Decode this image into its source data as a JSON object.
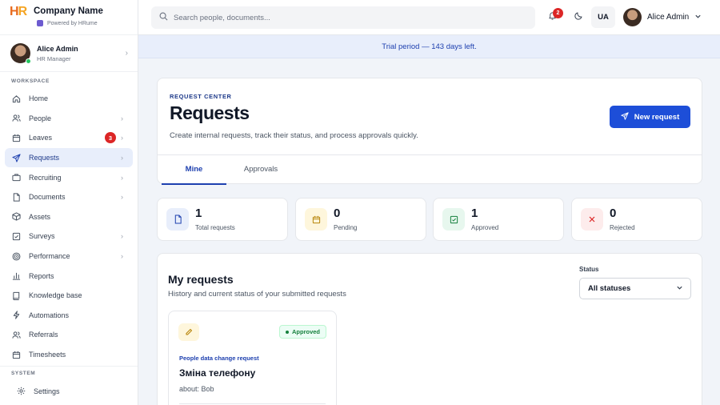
{
  "brand": {
    "logo": "HR",
    "company": "Company Name",
    "powered_by": "Powered by HRume"
  },
  "user": {
    "name": "Alice Admin",
    "role": "HR Manager"
  },
  "sidebar": {
    "workspace_label": "WORKSPACE",
    "items": [
      {
        "label": "Home",
        "icon": "home-icon"
      },
      {
        "label": "People",
        "icon": "users-icon"
      },
      {
        "label": "Leaves",
        "icon": "calendar-icon",
        "badge": "3"
      },
      {
        "label": "Requests",
        "icon": "send-icon"
      },
      {
        "label": "Recruiting",
        "icon": "briefcase-icon"
      },
      {
        "label": "Documents",
        "icon": "file-icon"
      },
      {
        "label": "Assets",
        "icon": "box-icon"
      },
      {
        "label": "Surveys",
        "icon": "checkbox-icon"
      },
      {
        "label": "Performance",
        "icon": "target-icon"
      },
      {
        "label": "Reports",
        "icon": "bar-chart-icon"
      },
      {
        "label": "Knowledge base",
        "icon": "book-icon"
      },
      {
        "label": "Automations",
        "icon": "bolt-icon"
      },
      {
        "label": "Referrals",
        "icon": "users-icon"
      },
      {
        "label": "Timesheets",
        "icon": "calendar-icon"
      }
    ],
    "system_label": "SYSTEM",
    "settings_label": "Settings"
  },
  "header": {
    "search_placeholder": "Search people, documents...",
    "notifications_count": "2",
    "language": "UA",
    "user_name": "Alice Admin"
  },
  "trial_banner": "Trial period — 143 days left.",
  "request_center": {
    "eyebrow": "REQUEST CENTER",
    "title": "Requests",
    "subtitle": "Create internal requests, track their status, and process approvals quickly.",
    "new_button": "New request",
    "tabs": [
      {
        "label": "Mine",
        "active": true
      },
      {
        "label": "Approvals",
        "active": false
      }
    ]
  },
  "stats": [
    {
      "value": "1",
      "label": "Total requests",
      "icon": "file-icon",
      "color": "#e8eefb"
    },
    {
      "value": "0",
      "label": "Pending",
      "icon": "calendar-icon",
      "color": "#fef6dc"
    },
    {
      "value": "1",
      "label": "Approved",
      "icon": "check-icon",
      "color": "#e7f7ee"
    },
    {
      "value": "0",
      "label": "Rejected",
      "icon": "close-icon",
      "color": "#fdecec"
    }
  ],
  "my_requests": {
    "title": "My requests",
    "subtitle": "History and current status of your submitted requests",
    "status_label": "Status",
    "status_value": "All statuses",
    "items": [
      {
        "status": "Approved",
        "type": "People data change request",
        "name": "Зміна телефону",
        "about": "about: Bob"
      }
    ]
  },
  "colors": {
    "accent": "#1d4ed8",
    "danger": "#dc2626",
    "success": "#15803d"
  }
}
